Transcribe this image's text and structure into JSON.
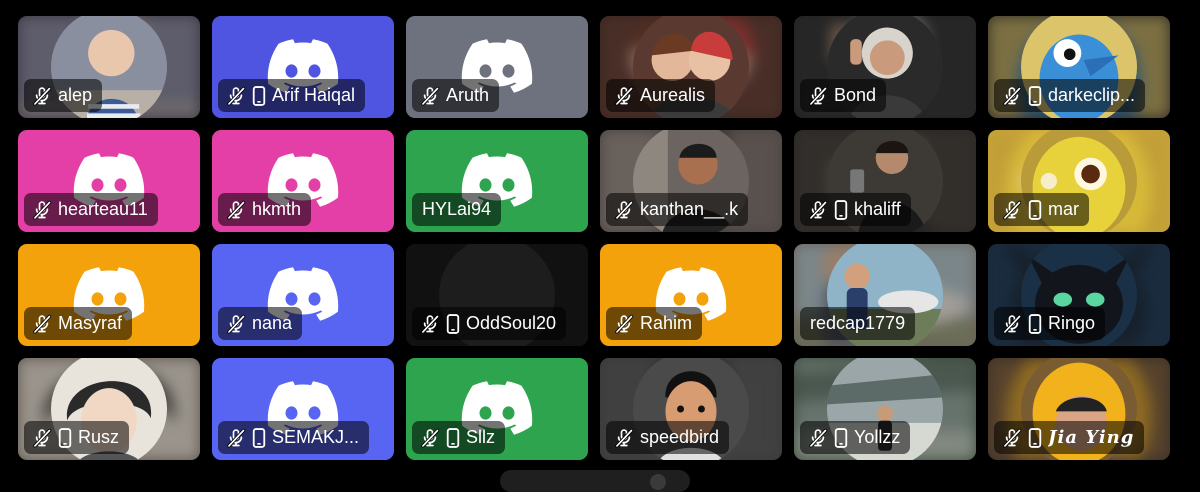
{
  "colors": {
    "background": "#000000",
    "label_bg": "rgba(0,0,0,0.55)",
    "label_text": "#ffffff"
  },
  "icons": {
    "muted": "muted-microphone-icon",
    "mobile": "mobile-phone-icon",
    "placeholder": "discord-logo-icon"
  },
  "tiles": [
    {
      "name": "alep",
      "muted": true,
      "mobile": false,
      "bg": "#3a3540",
      "avatar": "photo-child"
    },
    {
      "name": "Arif Haiqal",
      "muted": true,
      "mobile": true,
      "bg": "#4f55e0",
      "avatar": "discord-logo"
    },
    {
      "name": "Aruth",
      "muted": true,
      "mobile": false,
      "bg": "#6e727e",
      "avatar": "discord-logo"
    },
    {
      "name": "Aurealis",
      "muted": true,
      "mobile": false,
      "bg": "#3b2621",
      "avatar": "photo-couple-art"
    },
    {
      "name": "Bond",
      "muted": true,
      "mobile": false,
      "bg": "#242424",
      "avatar": "photo-man-white-hair"
    },
    {
      "name": "darkeclip...",
      "muted": true,
      "mobile": true,
      "bg": "#2d2a23",
      "avatar": "photo-blue-bird"
    },
    {
      "name": "hearteau11",
      "muted": true,
      "mobile": false,
      "bg": "#e43fa7",
      "avatar": "discord-logo"
    },
    {
      "name": "hkmth",
      "muted": true,
      "mobile": false,
      "bg": "#e43fa7",
      "avatar": "discord-logo"
    },
    {
      "name": "HYLai94",
      "muted": false,
      "mobile": false,
      "bg": "#2ea44f",
      "avatar": "discord-logo"
    },
    {
      "name": "kanthan__.k",
      "muted": true,
      "mobile": false,
      "bg": "#4a423f",
      "avatar": "photo-man-selfie"
    },
    {
      "name": "khaliff",
      "muted": true,
      "mobile": true,
      "bg": "#2a2724",
      "avatar": "photo-mirror-selfie"
    },
    {
      "name": "mar",
      "muted": true,
      "mobile": true,
      "bg": "#c9a437",
      "avatar": "photo-yellow-creature"
    },
    {
      "name": "Masyraf",
      "muted": true,
      "mobile": false,
      "bg": "#f4a20c",
      "avatar": "discord-logo"
    },
    {
      "name": "nana",
      "muted": true,
      "mobile": false,
      "bg": "#5865f2",
      "avatar": "discord-logo"
    },
    {
      "name": "OddSoul20",
      "muted": true,
      "mobile": true,
      "bg": "#111111",
      "avatar": "blank"
    },
    {
      "name": "Rahim",
      "muted": true,
      "mobile": false,
      "bg": "#f4a20c",
      "avatar": "discord-logo"
    },
    {
      "name": "redcap1779",
      "muted": false,
      "mobile": false,
      "bg": "#6b6258",
      "avatar": "photo-man-airplane"
    },
    {
      "name": "Ringo",
      "muted": true,
      "mobile": true,
      "bg": "#1b2a3a",
      "avatar": "photo-dark-dragon"
    },
    {
      "name": "Rusz",
      "muted": true,
      "mobile": true,
      "bg": "#5a534b",
      "avatar": "photo-anime-boy"
    },
    {
      "name": "SEMAKJ...",
      "muted": true,
      "mobile": true,
      "bg": "#5865f2",
      "avatar": "discord-logo"
    },
    {
      "name": "Sllz",
      "muted": true,
      "mobile": true,
      "bg": "#2ea44f",
      "avatar": "discord-logo"
    },
    {
      "name": "speedbird",
      "muted": true,
      "mobile": false,
      "bg": "#3a3a3a",
      "avatar": "photo-cartoon-man"
    },
    {
      "name": "Yollzz",
      "muted": true,
      "mobile": true,
      "bg": "#3c4a3c",
      "avatar": "photo-hangar"
    },
    {
      "name": "Jia Ying",
      "muted": true,
      "mobile": true,
      "bg": "#3a2e28",
      "avatar": "photo-yellow-hood"
    }
  ]
}
